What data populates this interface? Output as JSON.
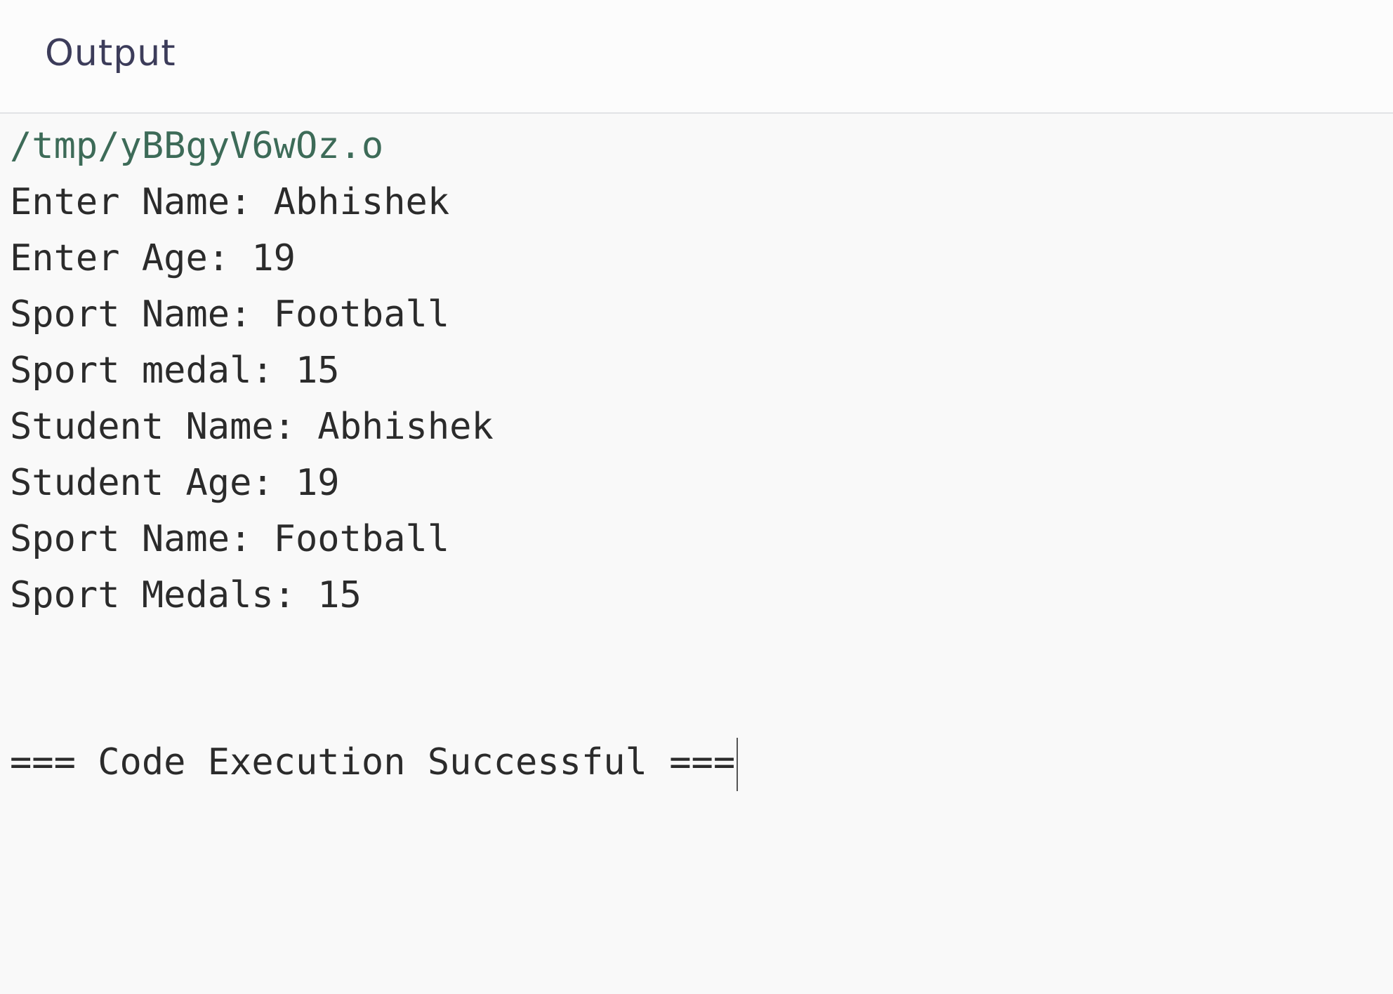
{
  "header": {
    "title": "Output"
  },
  "console": {
    "path": "/tmp/yBBgyV6wOz.o",
    "lines": [
      "Enter Name: Abhishek",
      "Enter Age: 19",
      "Sport Name: Football",
      "Sport medal: 15",
      "Student Name: Abhishek",
      "Student Age: 19",
      "Sport Name: Football",
      "Sport Medals: 15"
    ],
    "status": "=== Code Execution Successful ==="
  },
  "colors": {
    "background": "#f9f9f9",
    "header_text": "#3c3c5a",
    "path_text": "#3d6b58",
    "output_text": "#2b2b2b"
  }
}
